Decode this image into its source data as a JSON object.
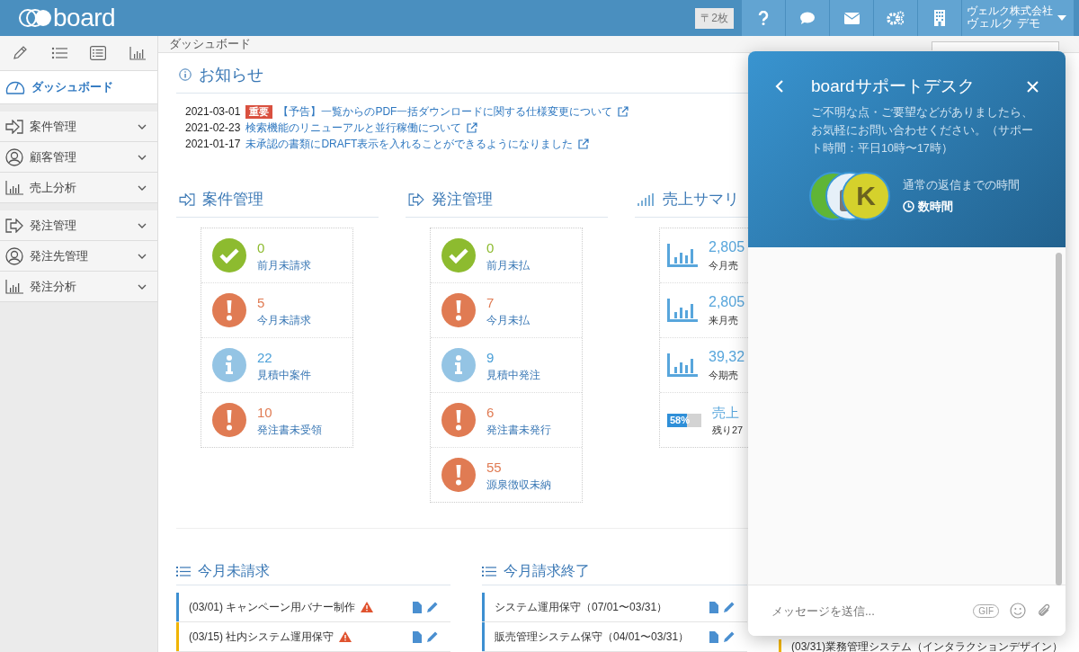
{
  "header": {
    "logo": "board",
    "badge": "〒2枚",
    "company": "ヴェルク株式会社",
    "user": "ヴェルク デモ"
  },
  "sidebar": {
    "groups": [
      [
        {
          "label": "ダッシュボード",
          "selected": true
        }
      ],
      [
        {
          "label": "案件管理",
          "selected": false
        },
        {
          "label": "顧客管理",
          "selected": false
        },
        {
          "label": "売上分析",
          "selected": false
        }
      ],
      [
        {
          "label": "発注管理",
          "selected": false
        },
        {
          "label": "発注先管理",
          "selected": false
        },
        {
          "label": "発注分析",
          "selected": false
        }
      ]
    ]
  },
  "breadcrumb": "ダッシュボード",
  "notices": {
    "title": "お知らせ",
    "items": [
      {
        "date": "2021-03-01",
        "tag": "重要",
        "text": "【予告】一覧からのPDF一括ダウンロードに関する仕様変更について"
      },
      {
        "date": "2021-02-23",
        "text": "検索機能のリニューアルと並行稼働について"
      },
      {
        "date": "2021-01-17",
        "text": "未承認の書類にDRAFT表示を入れることができるようになりました"
      }
    ]
  },
  "summaries": [
    {
      "title": "案件管理",
      "stats": [
        {
          "kind": "ok",
          "value": "0",
          "label": "前月未請求"
        },
        {
          "kind": "warn",
          "value": "5",
          "label": "今月未請求"
        },
        {
          "kind": "info",
          "value": "22",
          "label": "見積中案件"
        },
        {
          "kind": "warn",
          "value": "10",
          "label": "発注書未受領"
        }
      ]
    },
    {
      "title": "発注管理",
      "stats": [
        {
          "kind": "ok",
          "value": "0",
          "label": "前月未払"
        },
        {
          "kind": "warn",
          "value": "7",
          "label": "今月未払"
        },
        {
          "kind": "info",
          "value": "9",
          "label": "見積中発注"
        },
        {
          "kind": "warn",
          "value": "6",
          "label": "発注書未発行"
        },
        {
          "kind": "warn",
          "value": "55",
          "label": "源泉徴収未納"
        }
      ]
    }
  ],
  "sales": {
    "title": "売上サマリ",
    "rows": [
      {
        "value": "2,805",
        "label": "今月売"
      },
      {
        "value": "2,805",
        "label": "来月売"
      },
      {
        "value": "39,32",
        "label": "今期売"
      }
    ],
    "progress": {
      "level": 0.58,
      "percent": "58%",
      "title": "売上",
      "sub": "残り27"
    }
  },
  "lists": [
    {
      "title": "今月未請求",
      "rows": [
        {
          "text": "(03/01) キャンペーン用バナー制作",
          "warning": true,
          "color": "#3d8fd1"
        },
        {
          "text": "(03/15) 社内システム運用保守",
          "warning": true,
          "color": "#f0b400"
        }
      ]
    },
    {
      "title": "今月請求終了",
      "rows": [
        {
          "text": "システム運用保守（07/01〜03/31）",
          "warning": false,
          "color": "#3d8fd1"
        },
        {
          "text": "販売管理システム保守（04/01〜03/31）",
          "warning": false,
          "color": "#3d8fd1"
        }
      ]
    },
    {
      "rows": [
        {
          "text": "(03/31)業務管理システム（インタラクションデザイン）",
          "color": "#f0b400"
        }
      ]
    }
  ],
  "chat": {
    "title": "boardサポートデスク",
    "description": "ご不明な点・ご要望などがありましたら、お気軽にお問い合わせください。（サポート時間：平日10時〜17時）",
    "avatar_letter": "K",
    "reply_label": "通常の返信までの時間",
    "reply_time": "数時間",
    "placeholder": "メッセージを送信...",
    "gif": "GIF"
  }
}
